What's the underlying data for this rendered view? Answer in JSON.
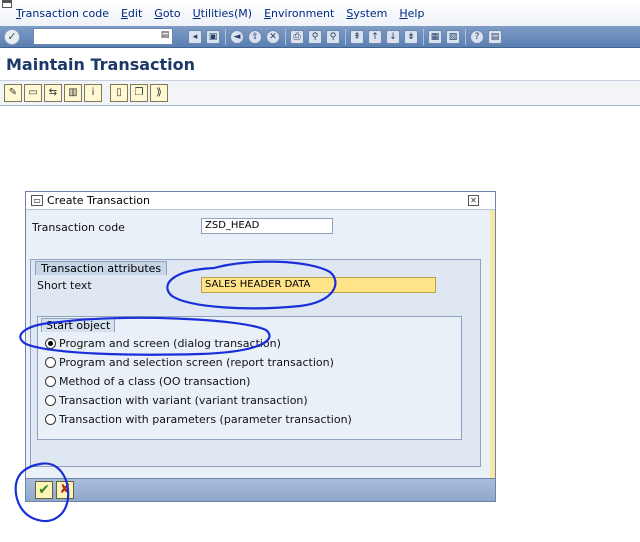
{
  "menubar": {
    "items": [
      "Transaction code",
      "Edit",
      "Goto",
      "Utilities(M)",
      "Environment",
      "System",
      "Help"
    ]
  },
  "toolbar": {
    "command_field_value": "",
    "icons": [
      "enter-icon",
      "history-dropdown-icon",
      "back-icon",
      "save-icon",
      "back-nav-icon",
      "exit-icon",
      "cancel-icon",
      "print-icon",
      "find-icon",
      "find-next-icon",
      "first-page-icon",
      "prev-page-icon",
      "next-page-icon",
      "last-page-icon",
      "new-session-icon",
      "shortcut-icon",
      "help-icon",
      "layout-icon"
    ]
  },
  "page": {
    "title": "Maintain Transaction"
  },
  "appbar": {
    "icons": [
      "display-change-icon",
      "change-icon",
      "copy-icon",
      "other-object-icon",
      "info-icon",
      "delete-icon",
      "create-copy-icon",
      "test-icon"
    ]
  },
  "dialog": {
    "title": "Create Transaction",
    "transaction_code_label": "Transaction code",
    "transaction_code_value": "ZSD_HEAD",
    "attributes_group_title": "Transaction attributes",
    "short_text_label": "Short text",
    "short_text_value": "SALES HEADER DATA",
    "start_object_title": "Start object",
    "options": [
      {
        "label": "Program and screen (dialog transaction)",
        "selected": true
      },
      {
        "label": "Program and selection screen (report transaction)",
        "selected": false
      },
      {
        "label": "Method of a class (OO transaction)",
        "selected": false
      },
      {
        "label": "Transaction with variant (variant transaction)",
        "selected": false
      },
      {
        "label": "Transaction with parameters (parameter transaction)",
        "selected": false
      }
    ],
    "ok_symbol": "✔",
    "cancel_symbol": "✘"
  },
  "colors": {
    "toolbar_blue": "#5a7fb3",
    "title_blue": "#1c3866",
    "input_yellow": "#ffe48a",
    "annotation_blue": "#1a2fd9"
  }
}
